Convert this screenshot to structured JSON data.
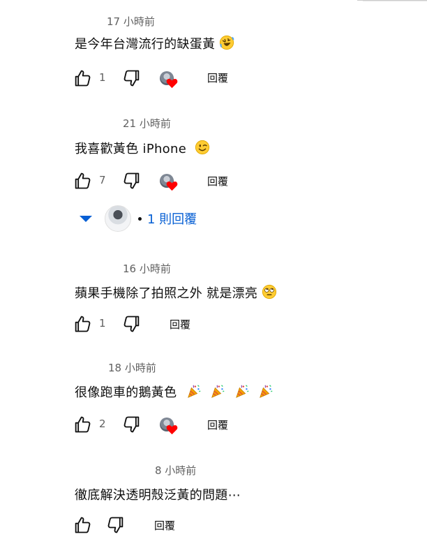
{
  "comments": [
    {
      "time": "17 小時前",
      "text": "是今年台灣流行的缺蛋黃",
      "emoji": "rofl",
      "likes": "1",
      "hearted": true,
      "reply_label": "回覆"
    },
    {
      "time": "21 小時前",
      "text": "我喜歡黃色 iPhone",
      "emoji": "wink",
      "likes": "7",
      "hearted": true,
      "reply_label": "回覆"
    },
    {
      "time": "16 小時前",
      "text": "蘋果手機除了拍照之外 就是漂亮",
      "emoji": "rolling-eyes",
      "likes": "1",
      "hearted": false,
      "reply_label": "回覆"
    },
    {
      "time": "18 小時前",
      "text": "很像跑車的鵝黃色",
      "emoji": "party-popper x4",
      "likes": "2",
      "hearted": true,
      "reply_label": "回覆"
    },
    {
      "time": "8 小時前",
      "text": "徹底解決透明殼泛黃的問題⋯",
      "emoji": "",
      "likes": "",
      "hearted": false,
      "reply_label": "回覆"
    }
  ],
  "replies_toggle": {
    "label": "1 則回覆"
  },
  "colors": {
    "link": "#065fd4",
    "heart": "#ff0000",
    "muted": "#606060"
  }
}
